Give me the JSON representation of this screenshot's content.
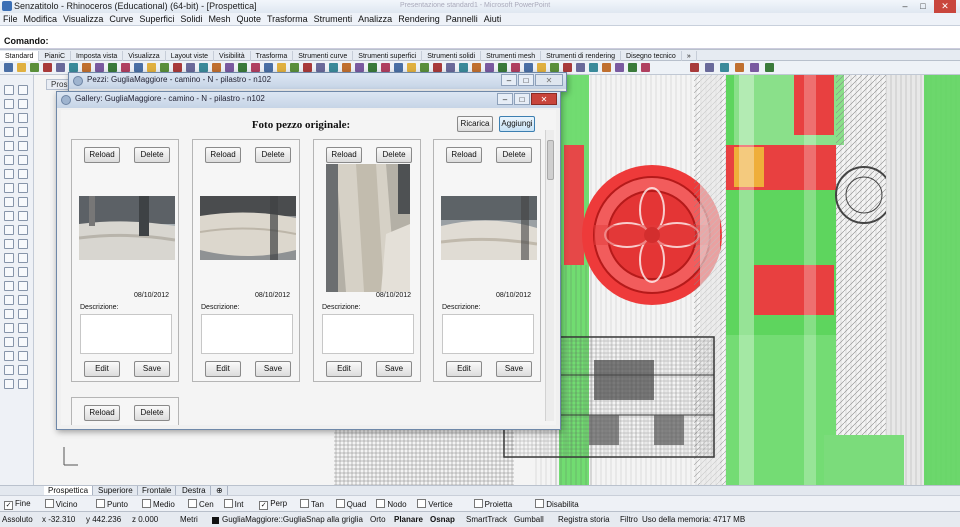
{
  "app": {
    "title": "Senzatitolo - Rhinoceros (Educational) (64-bit) - [Prospettica]",
    "ghost_title": "Presentazione standard1 - Microsoft PowerPoint"
  },
  "menu": [
    "File",
    "Modifica",
    "Visualizza",
    "Curve",
    "Superfici",
    "Solidi",
    "Mesh",
    "Quote",
    "Trasforma",
    "Strumenti",
    "Analizza",
    "Rendering",
    "Pannelli",
    "Aiuti"
  ],
  "command": {
    "label": "Comando:"
  },
  "toolbar_tabs": [
    "Standard",
    "PianiC",
    "Imposta vista",
    "Visualizza",
    "Layout viste",
    "Visibilità",
    "Trasforma",
    "Strumenti curve",
    "Strumenti superfici",
    "Strumenti solidi",
    "Strumenti mesh",
    "Strumenti di rendering",
    "Disegno tecnico",
    "»"
  ],
  "viewport": {
    "label": "Prospe"
  },
  "pezzi_window": {
    "title": "Pezzi: GugliaMaggiore - camino - N - pilastro - n102"
  },
  "gallery_window": {
    "title": "Gallery: GugliaMaggiore - camino - N - pilastro - n102",
    "heading": "Foto pezzo originale:",
    "ricarica": "Ricarica",
    "aggiungi": "Aggiungi",
    "cards": [
      {
        "reload": "Reload",
        "delete": "Delete",
        "date": "08/10/2012",
        "desc_label": "Descrizione:",
        "edit": "Edit",
        "save": "Save"
      },
      {
        "reload": "Reload",
        "delete": "Delete",
        "date": "08/10/2012",
        "desc_label": "Descrizione:",
        "edit": "Edit",
        "save": "Save"
      },
      {
        "reload": "Reload",
        "delete": "Delete",
        "date": "08/10/2012",
        "desc_label": "Descrizione:",
        "edit": "Edit",
        "save": "Save"
      },
      {
        "reload": "Reload",
        "delete": "Delete",
        "date": "08/10/2012",
        "desc_label": "Descrizione:",
        "edit": "Edit",
        "save": "Save"
      },
      {
        "reload": "Reload",
        "delete": "Delete"
      }
    ]
  },
  "view_tabs": [
    "Prospettica",
    "Superiore",
    "Frontale",
    "Destra",
    "⊕"
  ],
  "osnap": [
    {
      "label": "Fine",
      "checked": true
    },
    {
      "label": "Vicino",
      "checked": false
    },
    {
      "label": "Punto",
      "checked": false
    },
    {
      "label": "Medio",
      "checked": false
    },
    {
      "label": "Cen",
      "checked": false
    },
    {
      "label": "Int",
      "checked": false
    },
    {
      "label": "Perp",
      "checked": true
    },
    {
      "label": "Tan",
      "checked": false
    },
    {
      "label": "Quad",
      "checked": false
    },
    {
      "label": "Nodo",
      "checked": false
    },
    {
      "label": "Vertice",
      "checked": false
    },
    {
      "label": "Proietta",
      "checked": false
    },
    {
      "label": "Disabilita",
      "checked": false
    }
  ],
  "status": {
    "assoluto": "Assoluto",
    "x": "x -32.310",
    "y": "y 442.236",
    "z": "z 0.000",
    "units": "Metri",
    "layer": "GugliaMaggiore::Guglia",
    "snap_grid": "Snap alla griglia",
    "orto": "Orto",
    "planare": "Planare",
    "osnap": "Osnap",
    "smarttrack": "SmartTrack",
    "gumball": "Gumball",
    "registra": "Registra storia",
    "filtro": "Filtro",
    "memoria": "Uso della memoria: 4717 MB"
  },
  "colors": {
    "accent": "#3c7fb1",
    "highlight_red": "#e8312f",
    "highlight_green": "#4fd14f",
    "title_bg": "#dfe7f1"
  }
}
